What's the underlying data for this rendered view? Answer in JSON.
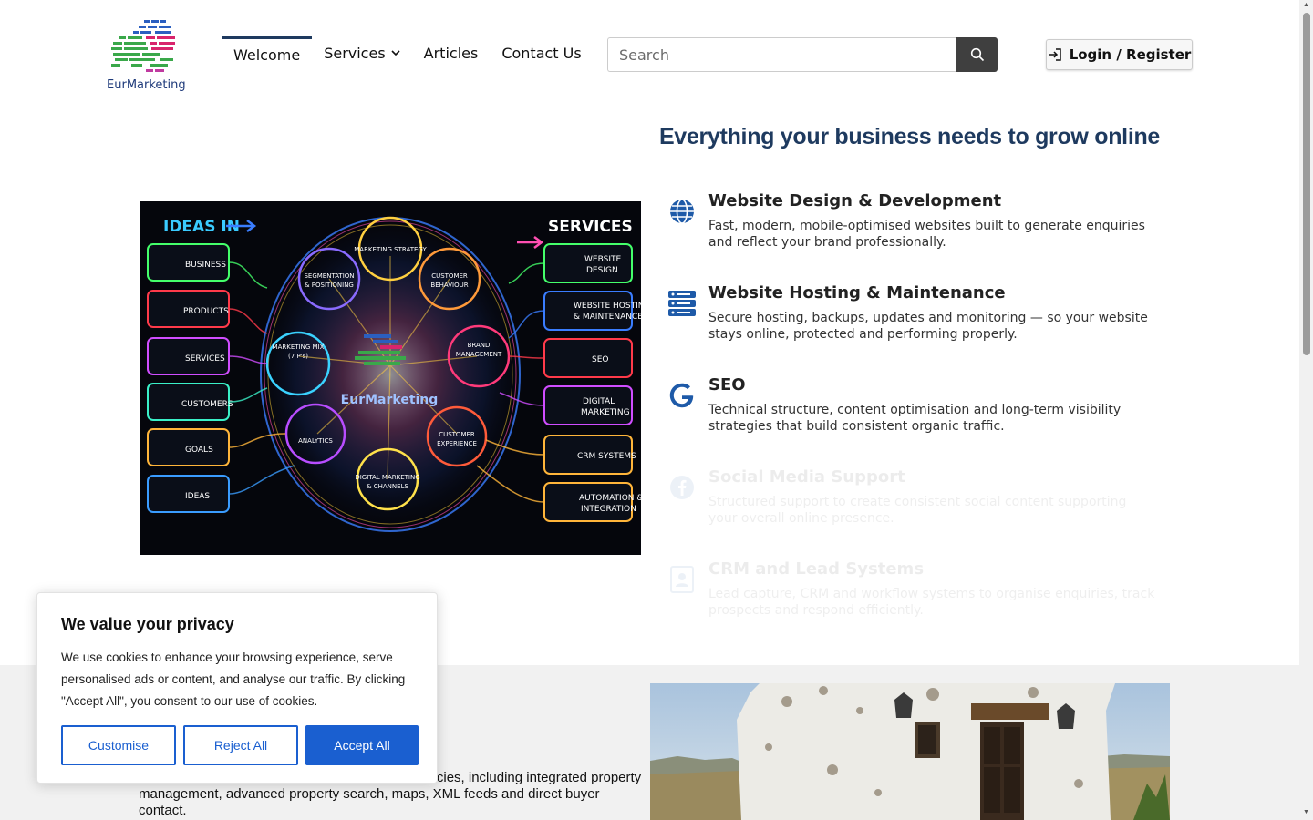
{
  "header": {
    "logo_text_a": "Eur",
    "logo_text_b": "Marketing",
    "nav": [
      {
        "label": "Welcome",
        "active": true
      },
      {
        "label": "Services",
        "has_dropdown": true
      },
      {
        "label": "Articles"
      },
      {
        "label": "Contact Us"
      }
    ],
    "search_placeholder": "Search",
    "login_label": "Login / Register"
  },
  "hero": {
    "title": "Everything your business needs to grow online",
    "image": {
      "left_heading": "IDEAS IN",
      "right_heading": "SERVICES",
      "center_label": "EurMarketing",
      "inputs": [
        "BUSINESS",
        "PRODUCTS",
        "SERVICES",
        "CUSTOMERS",
        "GOALS",
        "IDEAS"
      ],
      "outputs": [
        "WEBSITE DESIGN",
        "WEBSITE HOSTING & MAINTENANCE",
        "SEO",
        "DIGITAL MARKETING",
        "CRM SYSTEMS",
        "AUTOMATION & INTEGRATION"
      ],
      "nodes": [
        "MARKETING STRATEGY",
        "SEGMENTATION & POSITIONING",
        "CUSTOMER BEHAVIOUR",
        "MARKETING MIX (7 P's)",
        "BRAND MANAGEMENT",
        "ANALYTICS",
        "CUSTOMER EXPERIENCE",
        "DIGITAL MARKETING & CHANNELS"
      ]
    }
  },
  "services": [
    {
      "icon": "globe-icon",
      "title": "Website Design & Development",
      "desc": "Fast, modern, mobile-optimised websites built to generate enquiries and reflect your brand professionally."
    },
    {
      "icon": "server-icon",
      "title": "Website Hosting & Maintenance",
      "desc": "Secure hosting, backups, updates and monitoring — so your website stays online, protected and performing properly."
    },
    {
      "icon": "google-icon",
      "title": "SEO",
      "desc": "Technical structure, content optimisation and long-term visibility strategies that build consistent organic traffic."
    },
    {
      "icon": "facebook-icon",
      "title": "Social Media Support",
      "desc": "Structured support to create consistent social content supporting your overall online presence."
    },
    {
      "icon": "contact-card-icon",
      "title": "CRM and Lead Systems",
      "desc": "Lead capture, CRM and workflow systems to organise enquiries, track prospects and respond efficiently."
    }
  ],
  "lower": {
    "text": "Bespoke property portal solutions for estate agencies, including integrated property management, advanced property search, maps, XML feeds and direct buyer contact."
  },
  "cookie": {
    "title": "We value your privacy",
    "text": "We use cookies to enhance your browsing experience, serve personalised ads or content, and analyse our traffic. By clicking \"Accept All\", you consent to our use of cookies.",
    "customise": "Customise",
    "reject": "Reject All",
    "accept": "Accept All"
  },
  "colors": {
    "brand_navy": "#1e3a5f",
    "accent_blue": "#1a5fd0",
    "icon_blue": "#1e5aa8"
  }
}
